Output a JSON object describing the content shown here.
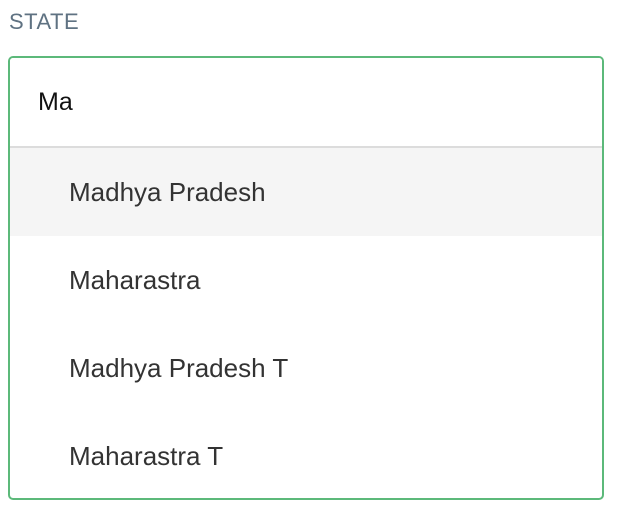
{
  "field": {
    "label": "STATE"
  },
  "search": {
    "value": "Ma",
    "placeholder": ""
  },
  "options": [
    {
      "label": "Madhya Pradesh",
      "highlighted": true
    },
    {
      "label": "Maharastra",
      "highlighted": false
    },
    {
      "label": "Madhya Pradesh T",
      "highlighted": false
    },
    {
      "label": "Maharastra T",
      "highlighted": false
    }
  ],
  "colors": {
    "label": "#5f7282",
    "focus_border": "#5cb97a",
    "highlight_bg": "#f5f5f5"
  }
}
